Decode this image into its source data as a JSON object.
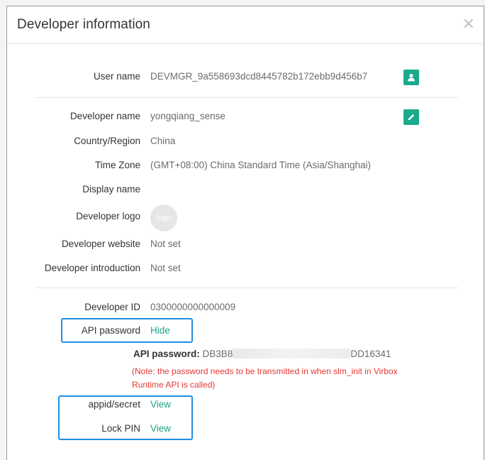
{
  "dialog": {
    "title": "Developer information",
    "close_glyph": "✕"
  },
  "fields": {
    "user_name": {
      "label": "User name",
      "value": "DEVMGR_9a558693dcd8445782b172ebb9d456b7"
    },
    "developer_name": {
      "label": "Developer name",
      "value": "yongqiang_sense"
    },
    "country_region": {
      "label": "Country/Region",
      "value": "China"
    },
    "time_zone": {
      "label": "Time Zone",
      "value": "(GMT+08:00) China Standard Time (Asia/Shanghai)"
    },
    "display_name": {
      "label": "Display name",
      "value": ""
    },
    "developer_logo": {
      "label": "Developer logo",
      "value": "logo"
    },
    "developer_website": {
      "label": "Developer website",
      "value": "Not set"
    },
    "developer_introduction": {
      "label": "Developer introduction",
      "value": "Not set"
    },
    "developer_id": {
      "label": "Developer ID",
      "value": "0300000000000009"
    },
    "api_password": {
      "label": "API password",
      "action": "Hide"
    },
    "appid_secret": {
      "label": "appid/secret",
      "action": "View"
    },
    "lock_pin": {
      "label": "Lock PIN",
      "action": "View"
    }
  },
  "api_password_reveal": {
    "label": "API password:",
    "prefix": "DB3B8",
    "suffix": "DD16341"
  },
  "note": "(Note: the password needs to be transmitted in when slm_init in Virbox Runtime API is called)",
  "icons": {
    "user_icon": "user-icon",
    "edit_icon": "pencil-icon"
  },
  "colors": {
    "accent": "#1aaa8e",
    "link": "#1ba589",
    "highlight_border": "#1e8fe6",
    "note_red": "#e53935"
  }
}
